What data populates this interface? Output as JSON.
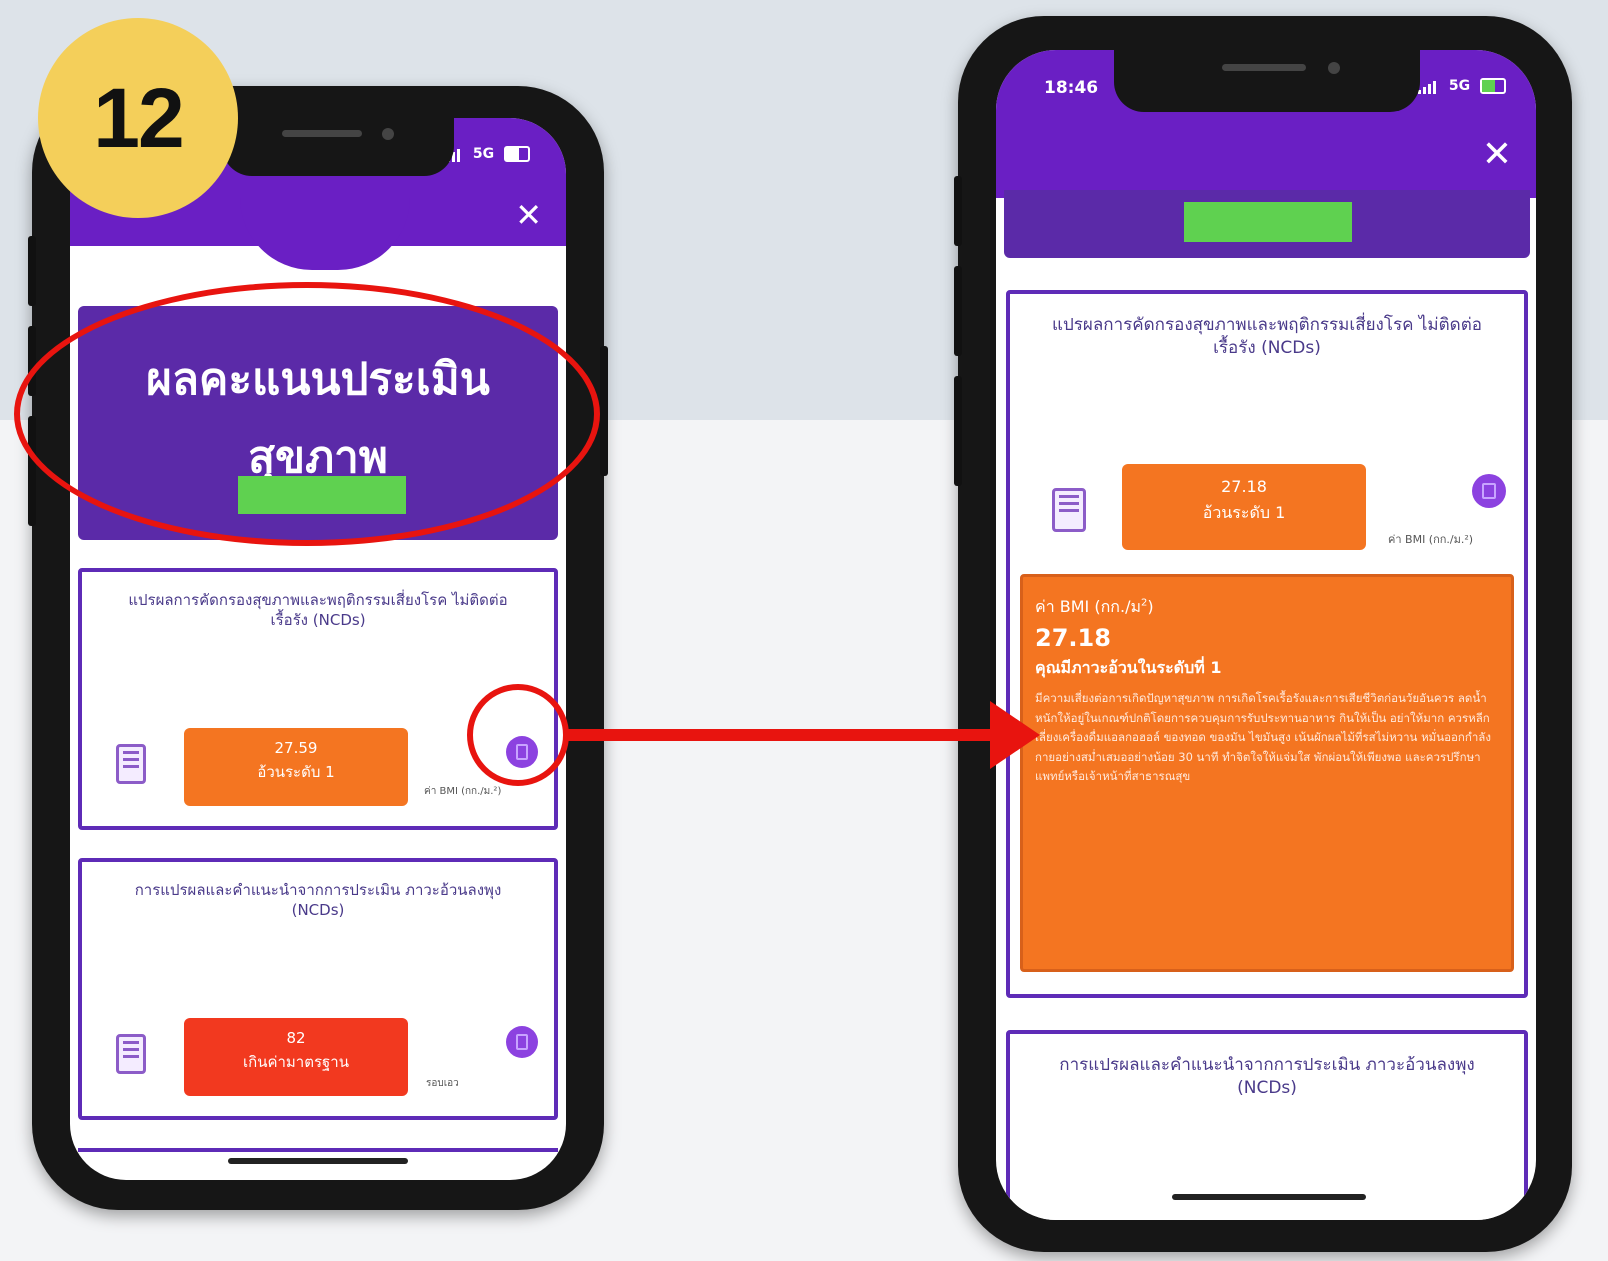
{
  "step_number": "12",
  "left_phone": {
    "status_network": "5G",
    "close_glyph": "✕",
    "title_line1": "ผลคะแนนประเมิน",
    "title_line2": "สุขภาพ",
    "card1": {
      "title": "แปรผลการคัดกรองสุขภาพและพฤติกรรมเสี่ยงโรค ไม่ติดต่อเรื้อรัง (NCDs)",
      "value": "27.59",
      "level": "อ้วนระดับ 1",
      "unit": "ค่า BMI (กก./ม.²)"
    },
    "card2": {
      "title": "การแปรผลและคำแนะนำจากการประเมิน ภาวะอ้วนลงพุง (NCDs)",
      "value": "82",
      "level": "เกินค่ามาตรฐาน",
      "unit": "รอบเอว"
    }
  },
  "right_phone": {
    "status_time": "18:46",
    "status_network": "5G",
    "close_glyph": "✕",
    "card1": {
      "title": "แปรผลการคัดกรองสุขภาพและพฤติกรรมเสี่ยงโรค ไม่ติดต่อเรื้อรัง (NCDs)",
      "value": "27.18",
      "level": "อ้วนระดับ 1",
      "unit": "ค่า BMI (กก./ม.²)"
    },
    "detail": {
      "label": "ค่า BMI (กก./ม",
      "label_sup": "2",
      "label_end": ")",
      "value": "27.18",
      "heading": "คุณมีภาวะอ้วนในระดับที่ 1",
      "body": "มีความเสี่ยงต่อการเกิดปัญหาสุขภาพ การเกิดโรคเรื้อรังและการเสียชีวิตก่อนวัยอันควร ลดน้ำหนักให้อยู่ในเกณฑ์ปกติโดยการควบคุมการรับประทานอาหาร กินให้เป็น อย่าให้มาก ควรหลีกเลี่ยงเครื่องดื่มแอลกอฮอล์ ของทอด ของมัน ไขมันสูง เน้นผักผลไม้ที่รสไม่หวาน หมั่นออกกำลังกายอย่างสม่ำเสมออย่างน้อย 30 นาที ทำจิตใจให้แจ่มใส พักผ่อนให้เพียงพอ และควรปรึกษาแพทย์หรือเจ้าหน้าที่สาธารณสุข"
    },
    "card2": {
      "title": "การแปรผลและคำแนะนำจากการประเมิน ภาวะอ้วนลงพุง (NCDs)"
    }
  },
  "colors": {
    "purple": "#6a1fc4",
    "card_border": "#5e2bb7",
    "orange": "#f47521",
    "red": "#f2391f",
    "highlight_red": "#e8140f",
    "step_badge": "#f4cf5a",
    "redaction": "#5fd150"
  }
}
